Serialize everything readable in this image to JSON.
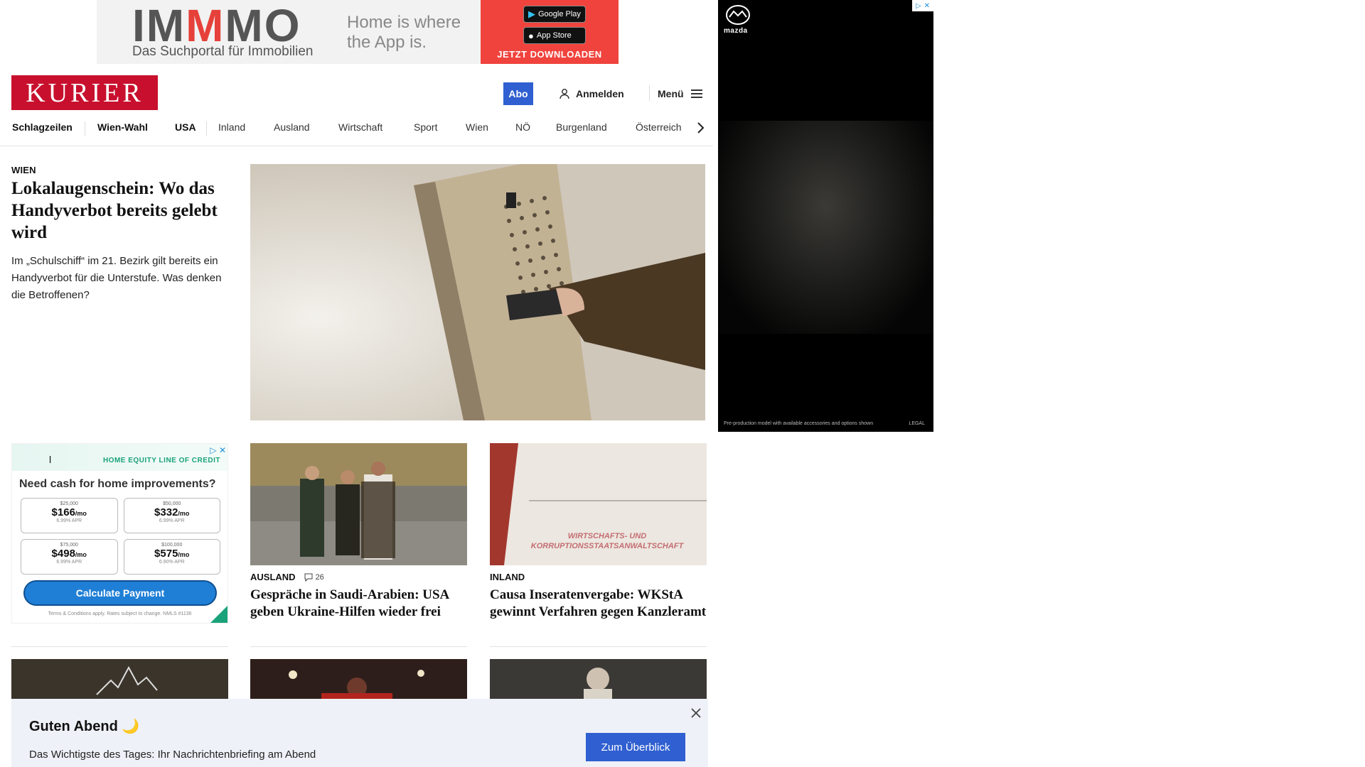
{
  "top_ad": {
    "logo_pre": "IM",
    "logo_mid": "M",
    "logo_post": "MO",
    "subline": "Das Suchportal für Immobilien",
    "tagline": "Home is where the App is.",
    "google_play": "Google Play",
    "app_store": "App Store",
    "cta": "JETZT DOWNLOADEN",
    "accent_color": "#f0433d"
  },
  "header": {
    "logo": "KURIER",
    "abo_label": "Abo",
    "login_label": "Anmelden",
    "menu_label": "Menü",
    "brand_color": "#c8102e"
  },
  "nav": {
    "items": [
      "Schlagzeilen",
      "Wien-Wahl",
      "USA",
      "Inland",
      "Ausland",
      "Wirtschaft",
      "Sport",
      "Wien",
      "NÖ",
      "Burgenland",
      "Österreich"
    ]
  },
  "lead": {
    "kicker": "WIEN",
    "title": "Lokalaugenschein: Wo das Handyverbot bereits gelebt wird",
    "teaser": "Im „Schulschiff“ im 21. Bezirk gilt bereits ein Handyverbot für die Unterstufe. Was denken die Betroffenen?"
  },
  "side_ad": {
    "brand": "mazda",
    "footnote": "Pre-production model with available accessories and options shown",
    "legal": "LEGAL"
  },
  "heloc_ad": {
    "label": "HOME EQUITY LINE OF CREDIT",
    "mark": "l",
    "question": "Need cash for home improvements?",
    "options": [
      {
        "amount": "$25,000",
        "monthly": "$166",
        "unit": "/mo",
        "apr": "6.99% APR"
      },
      {
        "amount": "$50,000",
        "monthly": "$332",
        "unit": "/mo",
        "apr": "6.99% APR"
      },
      {
        "amount": "$75,000",
        "monthly": "$498",
        "unit": "/mo",
        "apr": "6.99% APR"
      },
      {
        "amount": "$100,000",
        "monthly": "$575",
        "unit": "/mo",
        "apr": "6.90% APR"
      }
    ],
    "button": "Calculate Payment",
    "terms": "Terms & Conditions apply. Rates subject to change. NMLS #1136"
  },
  "cards": [
    {
      "kicker": "AUSLAND",
      "comments": "26",
      "title": "Gespräche in Saudi-Arabien: USA geben Ukraine-Hilfen wieder frei"
    },
    {
      "kicker": "INLAND",
      "title": "Causa Inseratenvergabe: WKStA gewinnt Verfahren gegen Kanzleramt",
      "image_text": "WIRTSCHAFTS- UND KORRUPTIONSSTAATSANWALTSCHAFT"
    }
  ],
  "toast": {
    "greeting": "Guten Abend 🌙",
    "description": "Das Wichtigste des Tages: Ihr Nachrichtenbriefing am Abend",
    "button": "Zum Überblick"
  }
}
